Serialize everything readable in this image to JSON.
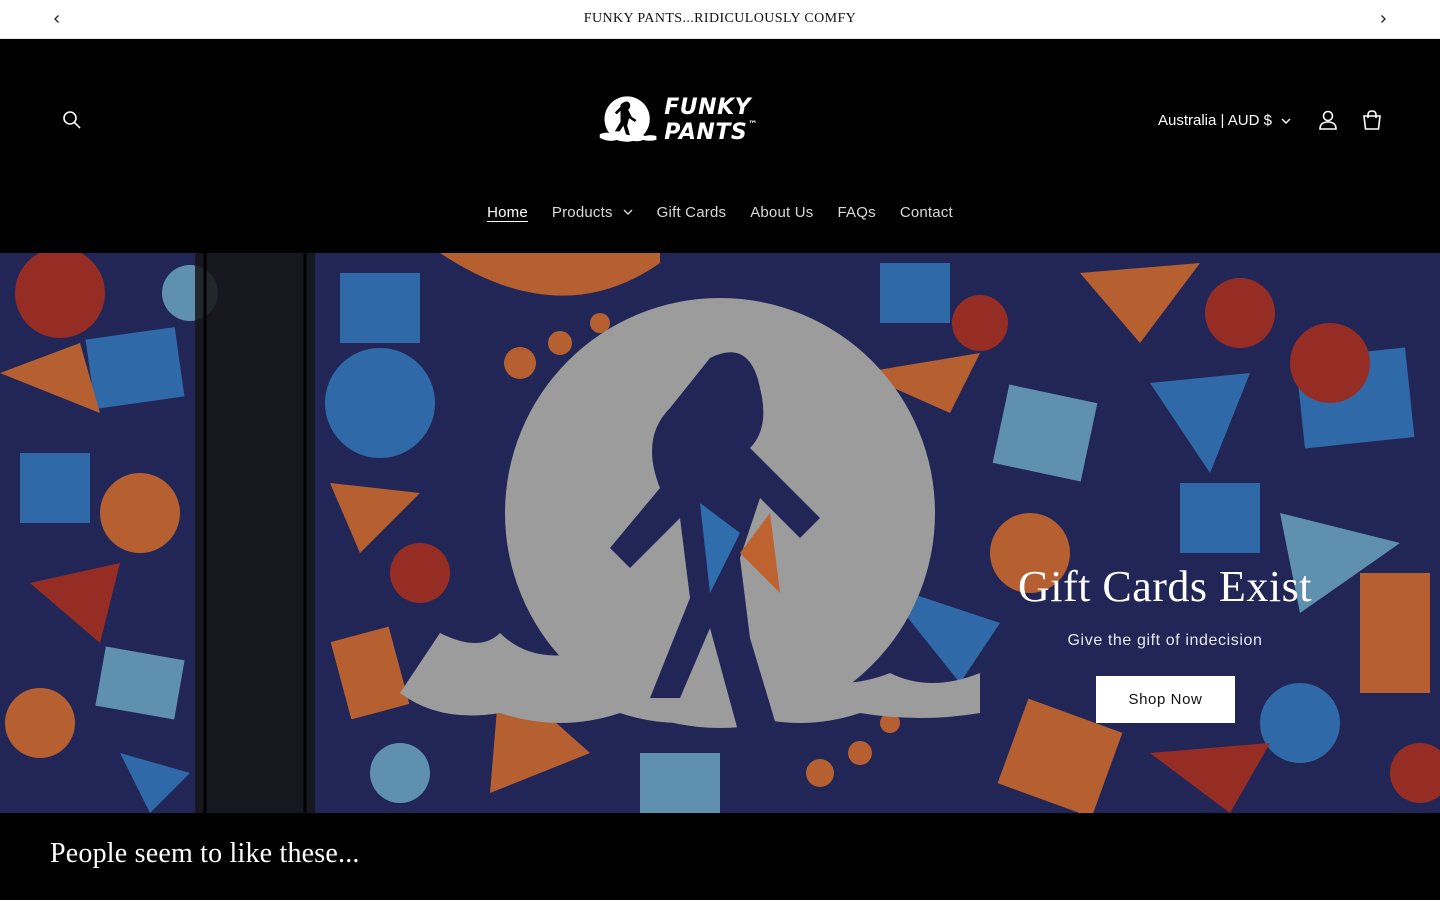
{
  "announcement": {
    "text": "FUNKY PANTS...RIDICULOUSLY COMFY",
    "prev_icon": "chevron-left-icon",
    "next_icon": "chevron-right-icon"
  },
  "header": {
    "logo_text": "FUNKY PANTS",
    "logo_mark": "™",
    "locale_label": "Australia | AUD $",
    "icons": [
      "search-icon",
      "account-icon",
      "cart-icon"
    ]
  },
  "nav": {
    "items": [
      {
        "label": "Home",
        "active": true
      },
      {
        "label": "Products",
        "has_dropdown": true
      },
      {
        "label": "Gift Cards"
      },
      {
        "label": "About Us"
      },
      {
        "label": "FAQs"
      },
      {
        "label": "Contact"
      }
    ]
  },
  "hero": {
    "title": "Gift Cards Exist",
    "subtitle": "Give the gift of indecision",
    "button_label": "Shop Now"
  },
  "featured": {
    "title": "People seem to like these..."
  },
  "colors": {
    "background": "#000000",
    "announcement_bg": "#ffffff",
    "hero_navy": "#2a2f6b",
    "hero_orange": "#e8793a",
    "hero_red": "#c0392b",
    "hero_blue": "#3b86d4",
    "hero_lightblue": "#79b8de"
  }
}
